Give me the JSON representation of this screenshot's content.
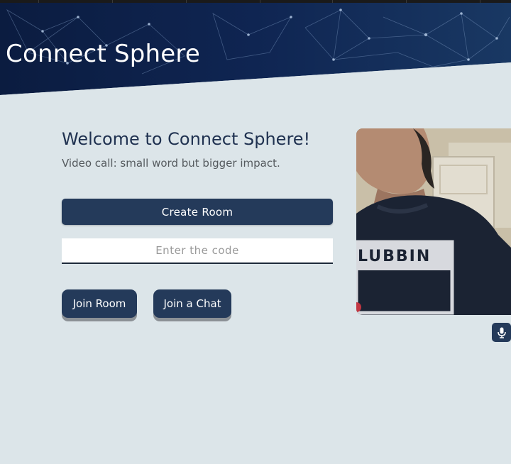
{
  "app": {
    "title": "Connect Sphere"
  },
  "welcome": {
    "heading": "Welcome to Connect Sphere!",
    "tagline": "Video call: small word but bigger impact."
  },
  "actions": {
    "create_room_label": "Create Room",
    "code_placeholder": "Enter the code",
    "code_value": "",
    "join_room_label": "Join Room",
    "join_chat_label": "Join a Chat"
  },
  "video_preview": {
    "shirt_text": "LUBBIN",
    "mic_icon": "microphone-icon"
  },
  "colors": {
    "background": "#dce5e9",
    "banner": "#0d1f45",
    "button": "#243a5a",
    "heading": "#1f3150"
  }
}
